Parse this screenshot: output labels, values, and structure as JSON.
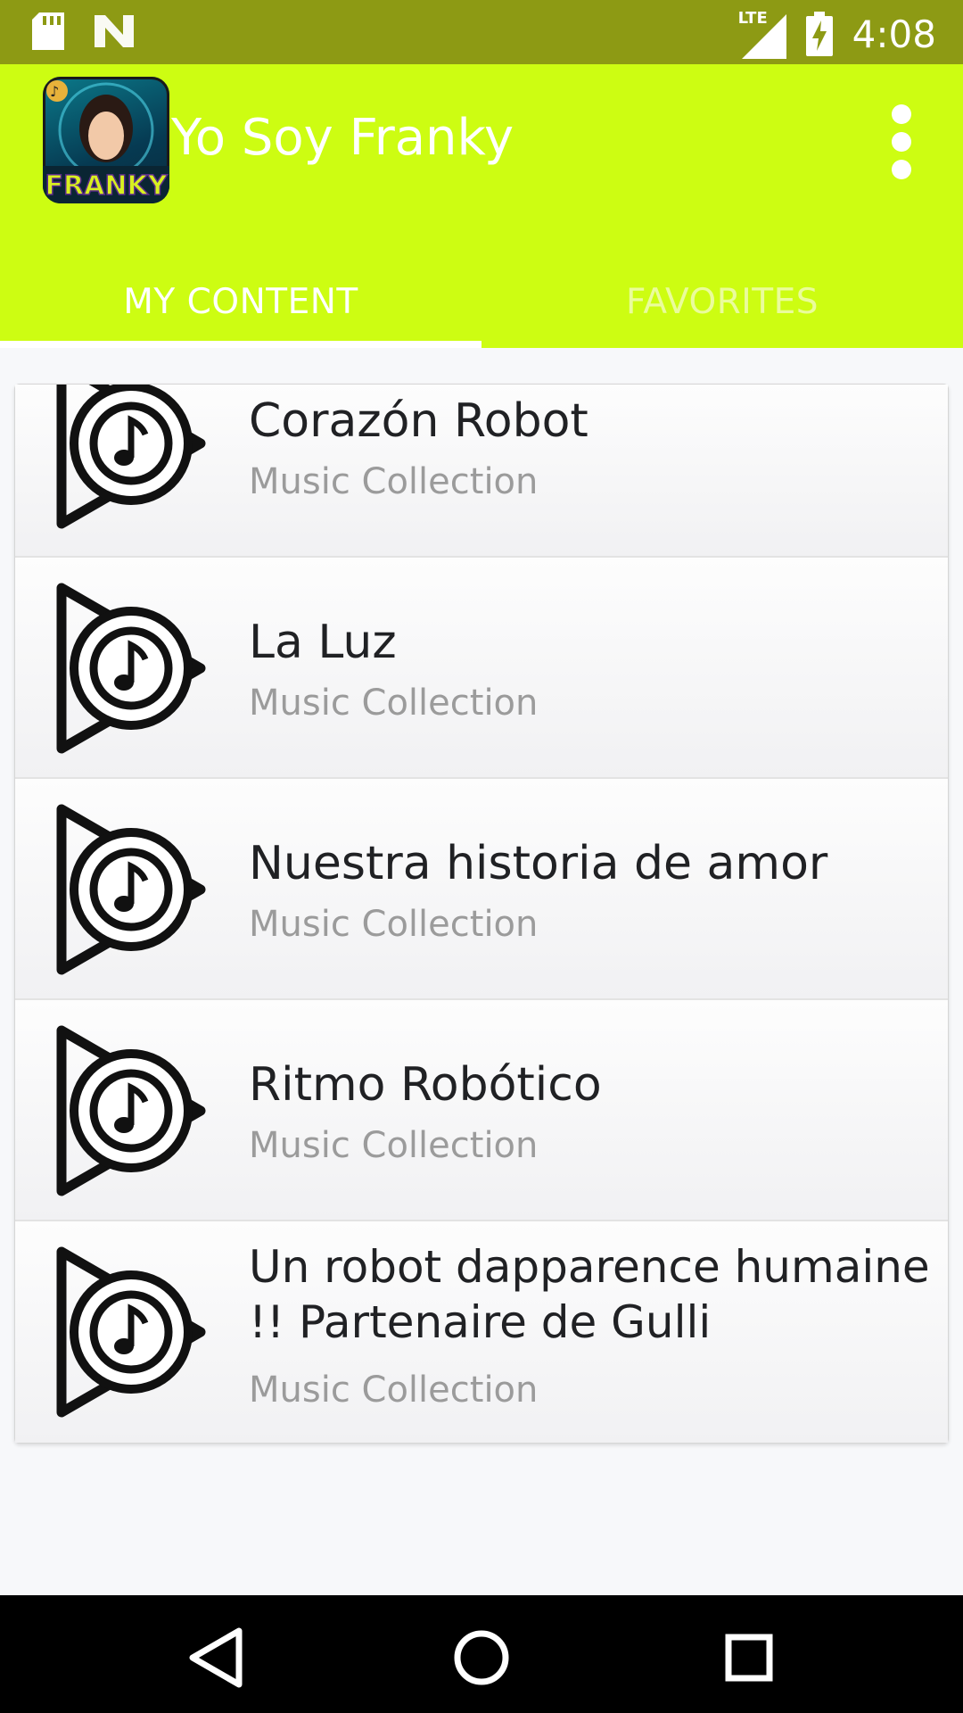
{
  "status_bar": {
    "time": "4:08",
    "network": "LTE",
    "left_icons": [
      "sd-card-icon",
      "n-notification-icon"
    ],
    "right_icons": [
      "signal-icon",
      "battery-charging-icon"
    ]
  },
  "app": {
    "title": "Yo Soy Franky",
    "logo_text": "FRANKY",
    "accent_color": "#cdfd12",
    "status_bar_color": "#8d9a14"
  },
  "tabs": [
    {
      "label": "MY CONTENT",
      "active": true
    },
    {
      "label": "FAVORITES",
      "active": false
    }
  ],
  "list": {
    "items": [
      {
        "title": "Corazón Robot",
        "subtitle": "Music Collection",
        "icon": "music-play-icon"
      },
      {
        "title": "La Luz",
        "subtitle": "Music Collection",
        "icon": "music-play-icon"
      },
      {
        "title": "Nuestra historia de amor",
        "subtitle": "Music Collection",
        "icon": "music-play-icon"
      },
      {
        "title": "Ritmo Robótico",
        "subtitle": "Music Collection",
        "icon": "music-play-icon"
      },
      {
        "title": "Un robot dapparence humaine !! Partenaire de Gulli",
        "subtitle": "Music Collection",
        "icon": "music-play-icon"
      }
    ]
  },
  "nav_bar": {
    "buttons": [
      "back-icon",
      "home-icon",
      "recents-icon"
    ]
  }
}
